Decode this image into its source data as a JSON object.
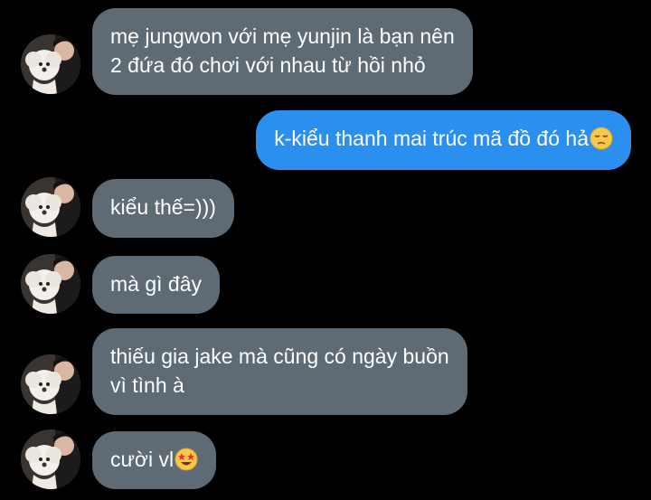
{
  "chat": {
    "messages": [
      {
        "side": "in",
        "lines": [
          "mẹ jungwon với mẹ yunjin là bạn nên",
          "2 đứa đó chơi với nhau từ hồi nhỏ"
        ]
      },
      {
        "side": "out",
        "lines": [
          "k-kiểu thanh mai trúc mã đồ đó hả"
        ],
        "emoji": "pensive-face-emoji"
      },
      {
        "side": "in",
        "lines": [
          "kiểu thế=)))"
        ]
      },
      {
        "side": "in",
        "lines": [
          "mà gì đây"
        ]
      },
      {
        "side": "in",
        "lines": [
          "thiếu gia jake mà cũng có ngày buồn",
          "vì tình à"
        ]
      },
      {
        "side": "in",
        "lines": [
          "cười vl"
        ],
        "emoji": "star-struck-emoji"
      }
    ]
  },
  "colors": {
    "background": "#000000",
    "incoming_bubble": "#5e6a74",
    "outgoing_bubble": "#2b8ff0",
    "text": "#ffffff"
  }
}
